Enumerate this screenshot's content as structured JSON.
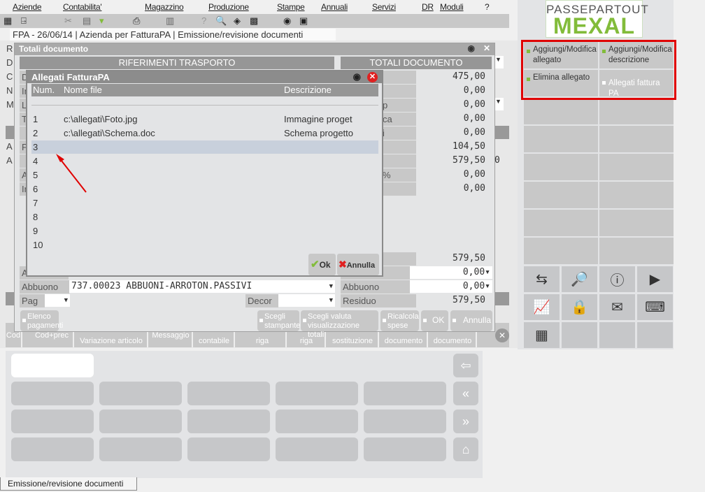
{
  "menu": [
    "Aziende",
    "Contabilita'",
    "Magazzino",
    "Produzione",
    "Stampe",
    "Annuali",
    "Servizi",
    "DR",
    "Moduli",
    "?"
  ],
  "toolbar_icons": [
    "grid-icon",
    "exit-icon",
    "scissors-icon",
    "paste-icon",
    "folder-icon",
    "print-icon",
    "transfer-icon",
    "help-icon",
    "search-doc-icon",
    "eraser-icon",
    "calculator-icon",
    "record-icon",
    "touch-screen-icon"
  ],
  "tabs": {
    "company": "FPA - 26/06/14",
    "azienda": "Azienda per FatturaPA",
    "program": "Emissione/revisione documenti"
  },
  "bg_letters": [
    "R",
    "D",
    "C",
    "N",
    "M",
    "0",
    "A",
    "A"
  ],
  "totali": {
    "title": "Totali documento",
    "left_header": "RIFERIMENTI TRASPORTO",
    "right_header": "TOTALI DOCUMENTO",
    "left_labels": [
      "D",
      "In",
      "Le",
      "Tr",
      "",
      "P",
      "",
      "A",
      "In"
    ],
    "right_labels": [
      "",
      "",
      "p",
      "ca",
      "i",
      "",
      "",
      "%",
      ""
    ],
    "right_values": [
      "475,00",
      "0,00",
      "0,00",
      "0,00",
      "0,00",
      "104,50",
      "579,50",
      "0,00",
      "0,00"
    ],
    "extra_value": "0",
    "total_value": "579,50",
    "a_label": "A",
    "a_value": "0,00",
    "abbuono_label": "Abbuono",
    "abbuono_conto": "737.00023 ABBUONI-ARROTON.PASSIVI",
    "abbuono_right_label": "Abbuono",
    "abbuono_value": "0,00",
    "pag_label": "Pag",
    "decor_label": "Decor",
    "residuo_label": "Residuo",
    "residuo_value": "579,50",
    "buttons": {
      "elenco": "Elenco pagamenti",
      "stampante": "Scegli stampante",
      "valuta": "Scegli valuta visualizzazione totali",
      "ricalcola": "Ricalcola spese",
      "ok": "OK",
      "annulla": "Annulla"
    }
  },
  "fkeys": [
    "Cod",
    "Cod+prec",
    "Variazione articolo",
    "Messaggio",
    "contabile",
    "riga",
    "riga",
    "sostituzione",
    "documento",
    "documento"
  ],
  "dialog": {
    "title": "Allegati FatturaPA",
    "columns": [
      "Num.",
      "Nome file",
      "Descrizione"
    ],
    "rows": [
      {
        "num": "1",
        "file": "c:\\allegati\\Foto.jpg",
        "desc": "Immagine proget"
      },
      {
        "num": "2",
        "file": "c:\\allegati\\Schema.doc",
        "desc": "Schema progetto"
      },
      {
        "num": "3",
        "file": "",
        "desc": ""
      },
      {
        "num": "4",
        "file": "",
        "desc": ""
      },
      {
        "num": "5",
        "file": "",
        "desc": ""
      },
      {
        "num": "6",
        "file": "",
        "desc": ""
      },
      {
        "num": "7",
        "file": "",
        "desc": ""
      },
      {
        "num": "8",
        "file": "",
        "desc": ""
      },
      {
        "num": "9",
        "file": "",
        "desc": ""
      },
      {
        "num": "10",
        "file": "",
        "desc": ""
      }
    ],
    "selected_row": 3,
    "ok": "Ok",
    "annulla": "Annulla"
  },
  "logo": {
    "top": "PASSEPARTOUT",
    "bottom": "MEXAL"
  },
  "side_actions": [
    {
      "label": "Aggiungi/Modifica allegato",
      "enabled": true
    },
    {
      "label": "Aggiungi/Modifica descrizione",
      "enabled": true
    },
    {
      "label": "Elimina allegato",
      "enabled": true
    },
    {
      "label": "Allegati fattura PA",
      "enabled": false
    }
  ],
  "colors": {
    "accent": "#82bc3a",
    "highlight": "#e00000",
    "selected_row": "#c8d0dc"
  },
  "status_tab": "Emissione/revisione documenti"
}
